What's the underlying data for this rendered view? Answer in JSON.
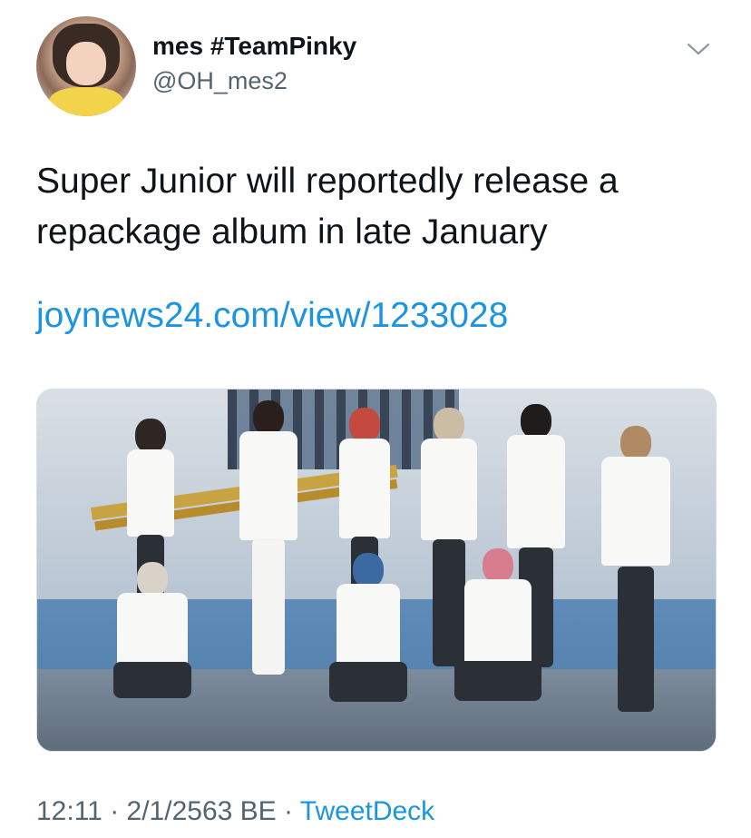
{
  "tweet": {
    "display_name": "mes #TeamPinky",
    "handle": "@OH_mes2",
    "text": "Super Junior will reportedly release a repackage album in late January",
    "link": "joynews24.com/view/1233028",
    "time": "12:11",
    "sep1": " · ",
    "date": "2/1/2563 BE",
    "sep2": " · ",
    "client": "TweetDeck"
  },
  "colors": {
    "link": "#1b95e0",
    "muted": "#536471",
    "text": "#0f1419"
  },
  "icons": {
    "menu": "chevron-down-icon"
  }
}
